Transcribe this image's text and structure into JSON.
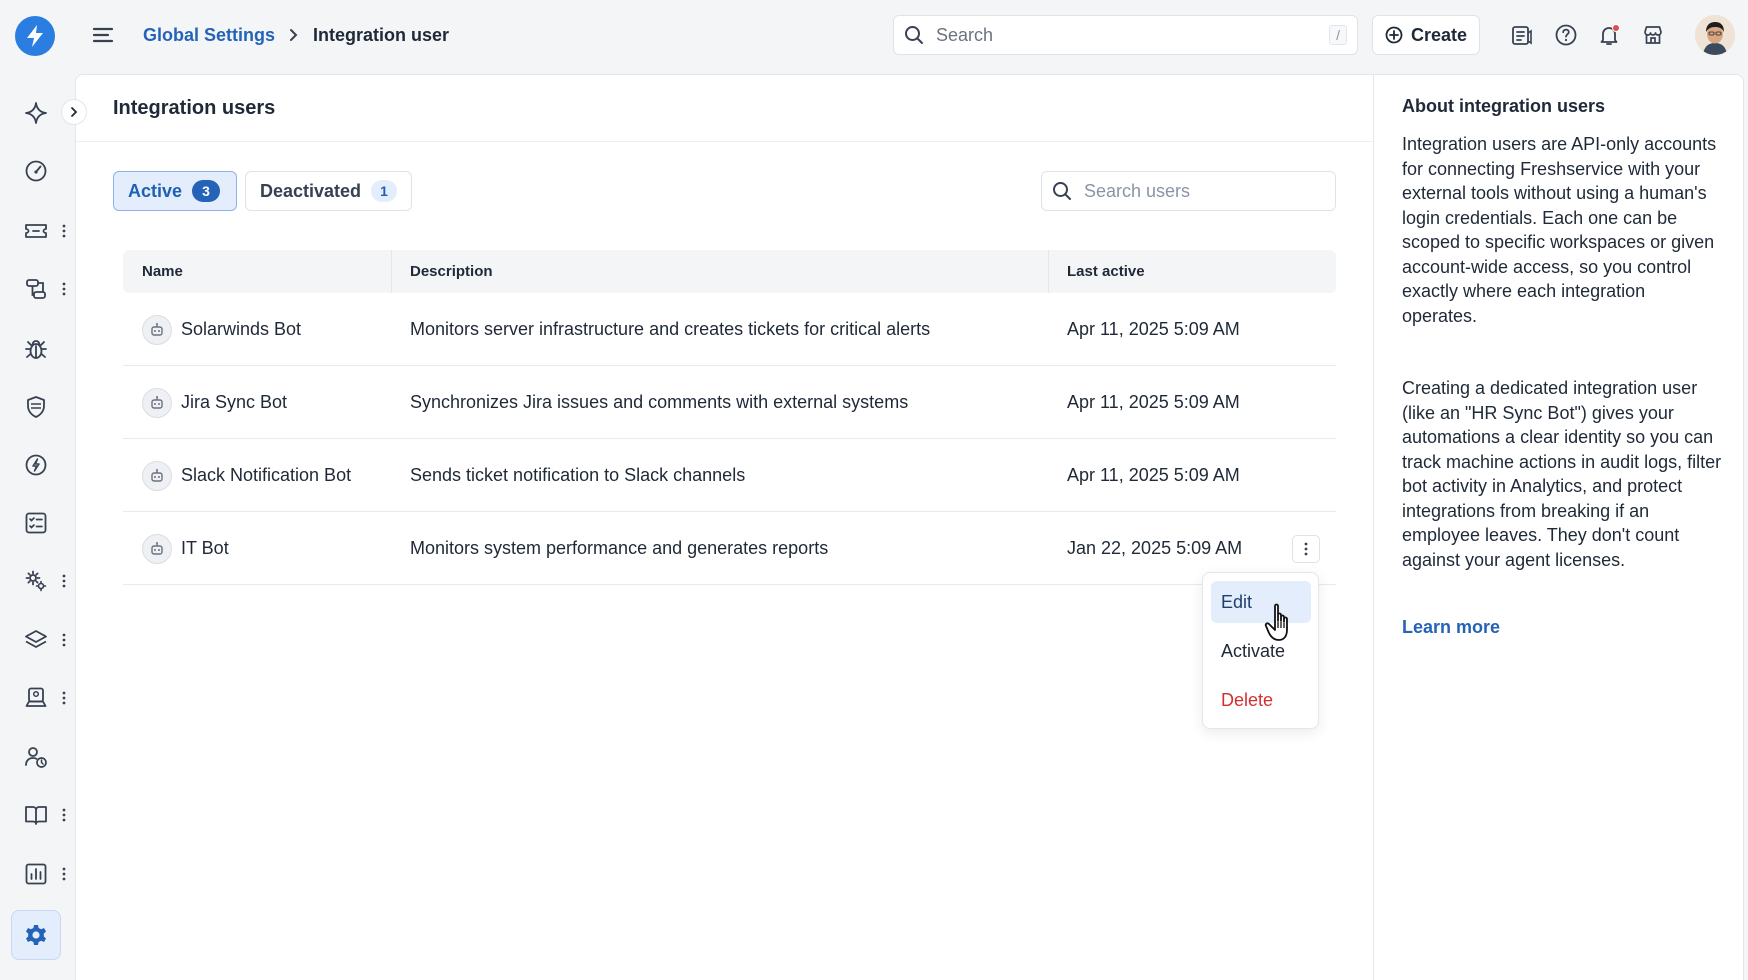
{
  "breadcrumb": {
    "parent": "Global Settings",
    "current": "Integration user"
  },
  "header": {
    "search_placeholder": "Search",
    "search_shortcut": "/",
    "create_label": "Create"
  },
  "page": {
    "title": "Integration users"
  },
  "tabs": [
    {
      "label": "Active",
      "count": "3"
    },
    {
      "label": "Deactivated",
      "count": "1"
    }
  ],
  "user_search": {
    "placeholder": "Search users"
  },
  "table": {
    "columns": [
      "Name",
      "Description",
      "Last active"
    ],
    "rows": [
      {
        "name": "Solarwinds Bot",
        "description": "Monitors server infrastructure and creates tickets for critical alerts",
        "last_active": "Apr 11, 2025 5:09 AM"
      },
      {
        "name": "Jira Sync Bot",
        "description": "Synchronizes Jira issues and comments with external systems",
        "last_active": "Apr 11, 2025 5:09 AM"
      },
      {
        "name": "Slack Notification Bot",
        "description": "Sends ticket notification to Slack channels",
        "last_active": "Apr 11, 2025 5:09 AM"
      },
      {
        "name": "IT Bot",
        "description": "Monitors system performance and generates reports",
        "last_active": "Jan 22, 2025 5:09 AM"
      }
    ]
  },
  "row_menu": {
    "edit": "Edit",
    "activate": "Activate",
    "delete": "Delete"
  },
  "side_panel": {
    "title": "About integration users",
    "paragraph1": "Integration users are API-only accounts for connecting Freshservice with your external tools without using a human's login credentials. Each one can be scoped to specific workspaces or given account-wide access, so you control exactly where each integration operates.",
    "paragraph2": "Creating a dedicated integration user (like an \"HR Sync Bot\") gives your automations a clear identity so you can track machine actions in audit logs, filter bot activity in Analytics, and protect integrations from breaking if an employee leaves. They don't count against your agent licenses.",
    "learn_more": "Learn more"
  },
  "icons": {
    "logo": "lightning-bolt-icon",
    "rail": [
      "sparkle-icon",
      "gauge-icon",
      "ticket-icon",
      "workflow-icon",
      "bug-icon",
      "shield-icon",
      "change-icon",
      "checklist-icon",
      "service-gear-icon",
      "layers-icon",
      "device-icon",
      "user-clock-icon",
      "book-icon",
      "report-chart-icon",
      "settings-gear-icon"
    ]
  },
  "colors": {
    "accent": "#2563b8",
    "danger": "#d32f2f",
    "active_bg": "#e3edfb"
  }
}
